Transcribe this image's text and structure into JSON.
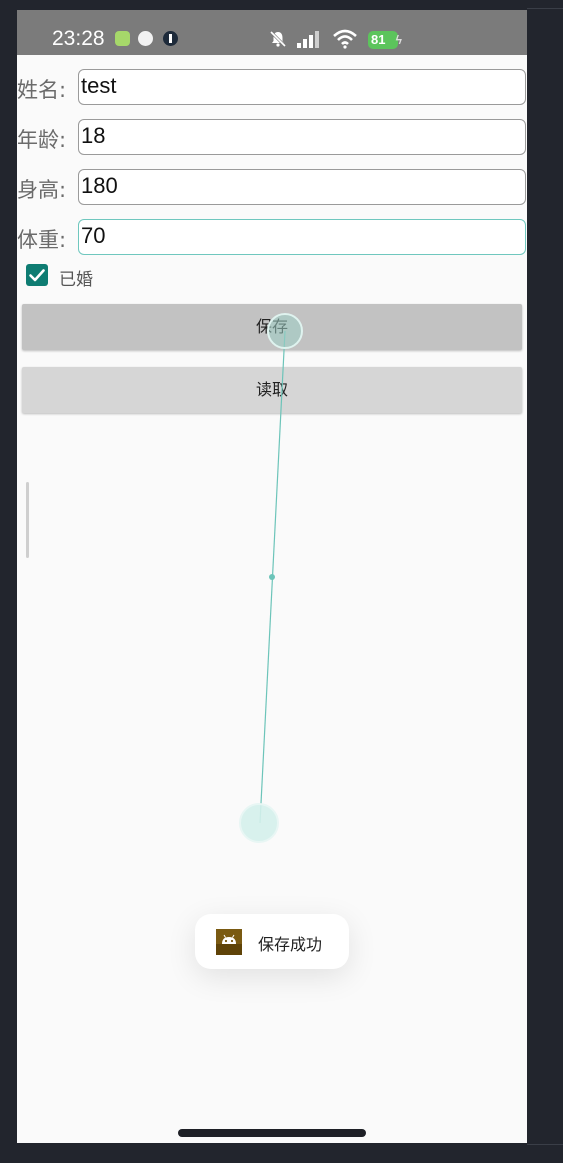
{
  "status_bar": {
    "time": "23:28",
    "battery_level": "81",
    "icons": [
      "app-notification-icon",
      "cat-app-icon",
      "app-icon",
      "mute-bell-icon",
      "signal-icon",
      "wifi-icon",
      "charging-icon"
    ]
  },
  "form": {
    "name": {
      "label": "姓名:",
      "value": "test"
    },
    "age": {
      "label": "年龄:",
      "value": "18"
    },
    "height": {
      "label": "身高:",
      "value": "180"
    },
    "weight": {
      "label": "体重:",
      "value": "70"
    }
  },
  "married": {
    "label": "已婚",
    "checked": true
  },
  "buttons": {
    "save_label": "保存",
    "read_label": "读取"
  },
  "toast": {
    "message": "保存成功",
    "icon": "android-icon"
  },
  "colors": {
    "accent": "#0e7c72",
    "focus_border": "#6fc7be",
    "status_bar_bg": "#7b7b7b",
    "battery": "#5cc45c"
  }
}
